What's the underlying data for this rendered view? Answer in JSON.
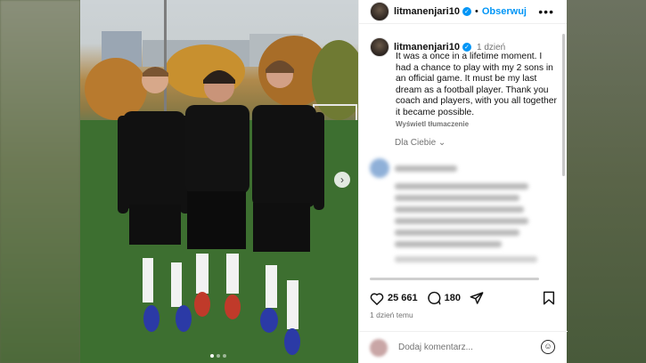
{
  "post": {
    "username": "litmanenjari10",
    "follow_label": "Obserwuj",
    "separator": "•",
    "more_label": "•••",
    "caption": {
      "time": "1 dzień",
      "text": "It was a once in a lifetime moment. I had a chance to play with my 2 sons in an official game. It must be my last dream as a football player. Thank you coach and  players, with you all together it became possible.",
      "translate_label": "Wyświetl tłumaczenie"
    },
    "for_you_label": "Dla Ciebie",
    "likes": "25 661",
    "comments": "180",
    "date": "1 dzień temu",
    "comment_placeholder": "Dodaj komentarz...",
    "carousel": {
      "dots": 3,
      "active_index": 0
    }
  },
  "icons": {
    "verified": "verified-badge-icon",
    "heart": "heart-icon",
    "comment": "comment-bubble-icon",
    "share": "paper-plane-icon",
    "bookmark": "bookmark-icon",
    "emoji": "emoji-icon",
    "next": "chevron-right-icon",
    "chevron_down": "chevron-down-icon"
  },
  "colors": {
    "accent": "#0095f6",
    "text": "#111111",
    "muted": "#737373"
  }
}
